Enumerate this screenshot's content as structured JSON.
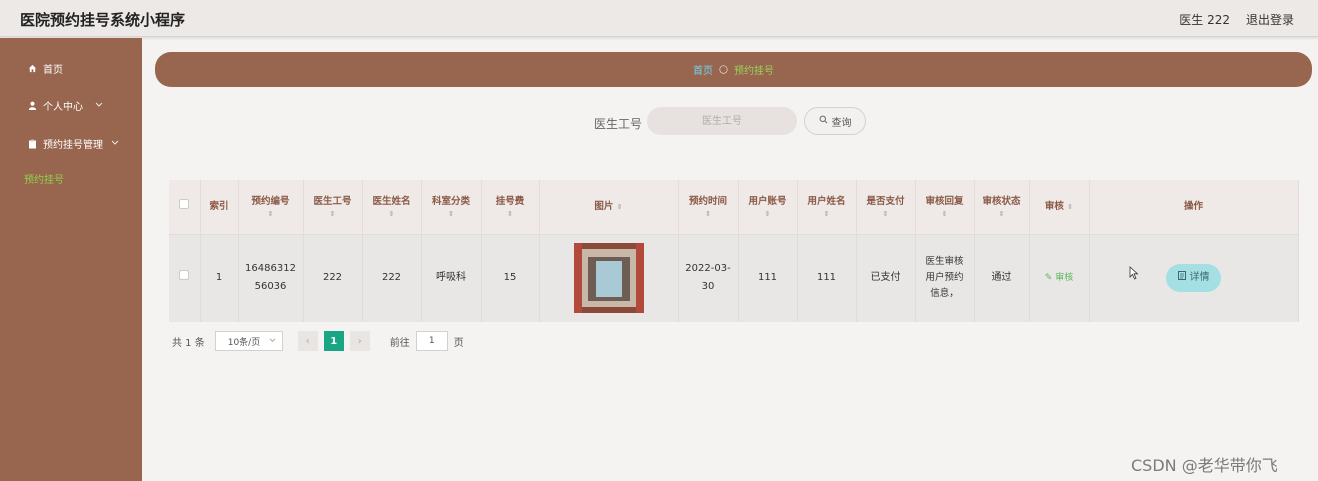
{
  "app": {
    "title": "医院预约挂号系统小程序"
  },
  "header": {
    "user": "医生 222",
    "logout": "退出登录"
  },
  "sidebar": {
    "items": [
      {
        "label": "首页",
        "icon": "home-icon"
      },
      {
        "label": "个人中心",
        "icon": "user-icon"
      },
      {
        "label": "预约挂号管理",
        "icon": "clipboard-icon"
      }
    ],
    "active_sub": "预约挂号"
  },
  "breadcrumb": {
    "home": "首页",
    "separator": "〇",
    "current": "预约挂号"
  },
  "search": {
    "label": "医生工号",
    "placeholder": "医生工号",
    "button": "查询"
  },
  "table": {
    "columns": [
      "索引",
      "预约编号",
      "医生工号",
      "医生姓名",
      "科室分类",
      "挂号费",
      "图片",
      "预约时间",
      "用户账号",
      "用户姓名",
      "是否支付",
      "审核回复",
      "审核状态",
      "审核",
      "操作"
    ],
    "rows": [
      {
        "index": "1",
        "booking_no": "1648631256036",
        "doctor_id": "222",
        "doctor_name": "222",
        "department": "呼吸科",
        "fee": "15",
        "time": "2022-03-30",
        "user_account": "111",
        "user_name": "111",
        "paid": "已支付",
        "reply": "医生审核用户预约信息，",
        "status": "通过",
        "audit": "审核",
        "detail": "详情"
      }
    ]
  },
  "pagination": {
    "total": "共 1 条",
    "page_size": "10条/页",
    "current": "1",
    "goto_prefix": "前往",
    "goto_value": "1",
    "goto_suffix": "页"
  },
  "watermark": "CSDN @老华带你飞",
  "colors": {
    "sidebar": "#98654f",
    "accent_green": "#1aa683",
    "detail_button": "#a3dfe3"
  }
}
